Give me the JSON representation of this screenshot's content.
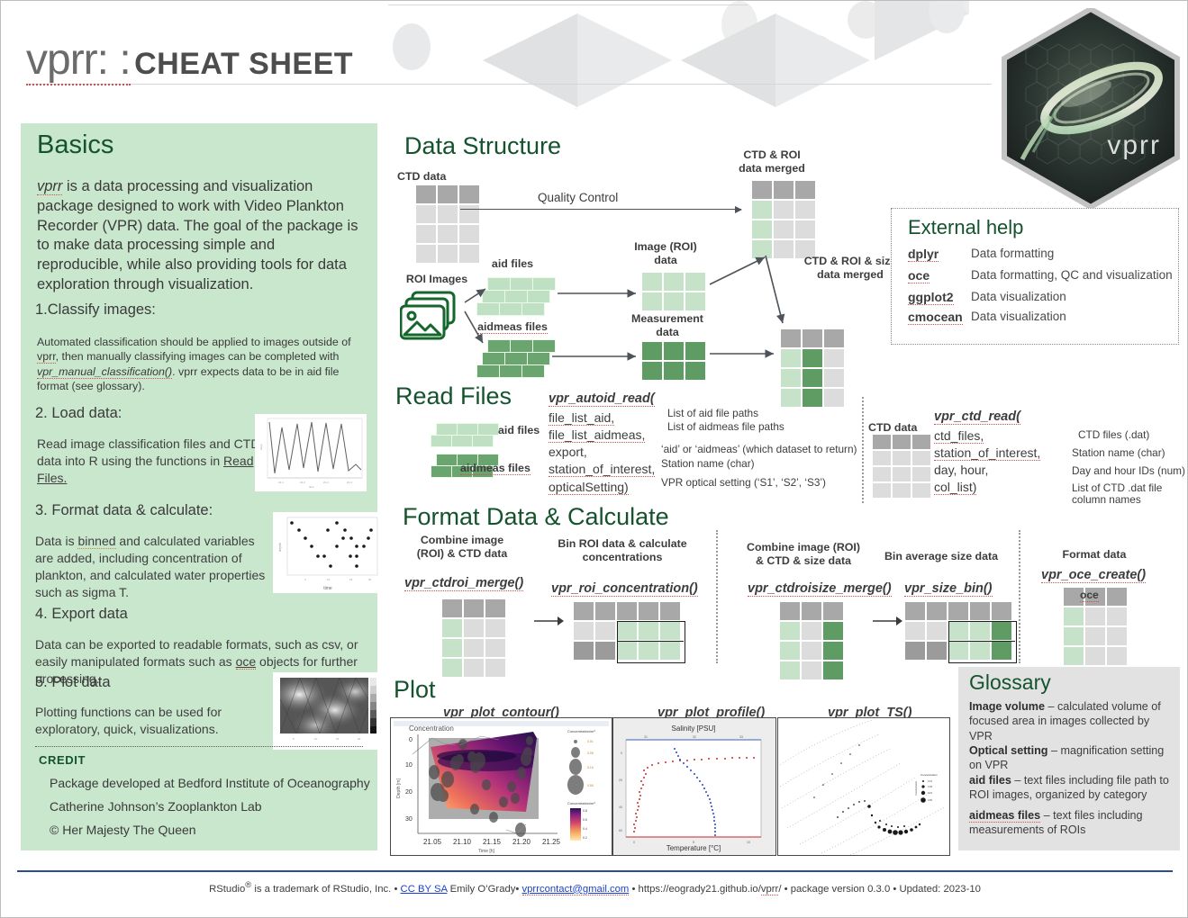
{
  "title": {
    "package": "vprr: :",
    "suffix": "CHEAT SHEET"
  },
  "logo": {
    "label": "vprr"
  },
  "basics": {
    "heading": "Basics",
    "intro_pkg": "vprr",
    "intro": " is a data processing and visualization package designed to work with Video Plankton Recorder  (VPR) data. The goal of the package is to make data processing simple and reproducible, while also providing tools for data exploration through visualization.",
    "steps": [
      {
        "num": "1.",
        "title": "Classify images:",
        "body_a": "Automated classification should be applied to images outside of ",
        "body_pkg1": "vprr",
        "body_b": ", then manually classifying images can be completed with ",
        "body_fn": "vpr_manual_classification()",
        "body_c": ".  vprr expects data to be in aid file format (see glossary)."
      },
      {
        "num": "2.",
        "title": "Load data:",
        "body_a": "Read image classification files and CTD data into R using the functions in ",
        "link": "Read Files."
      },
      {
        "num": "3.",
        "title": "Format data & calculate:",
        "body_a": " Data is ",
        "word": "binned",
        "body_b": " and calculated variables are added, including concentration of plankton, and calculated water properties such as sigma T."
      },
      {
        "num": "4.",
        "title": "Export data",
        "body_a": "Data can be exported to readable formats, such as csv, or easily manipulated formats such as ",
        "word": "oce",
        "body_b": " objects for further processing."
      },
      {
        "num": "5.",
        "title": "Plot data",
        "body_a": "Plotting functions can be used for exploratory, quick, visualizations."
      }
    ],
    "credit_heading": "CREDIT",
    "credit_lines": [
      "Package developed at Bedford Institute of Oceanography",
      "Catherine Johnson’s Zooplankton Lab",
      "© Her Majesty The Queen"
    ]
  },
  "data_structure": {
    "heading": "Data Structure",
    "labels": {
      "ctd_data": "CTD data",
      "roi_images": "ROI Images",
      "aid_files": "aid files",
      "aidmeas_files": "aidmeas files",
      "image_roi_data": "Image (ROI)\ndata",
      "measurement_data": "Measurement\ndata",
      "ctd_roi_merged": "CTD & ROI\ndata merged",
      "ctd_roi_size_merged": "CTD & ROI & size\ndata merged",
      "quality_control": "Quality Control"
    }
  },
  "external_help": {
    "heading": "External help",
    "rows": [
      {
        "pkg": "dplyr",
        "desc": "Data formatting"
      },
      {
        "pkg": "oce",
        "desc": "Data formatting, QC and visualization"
      },
      {
        "pkg": "ggplot2",
        "desc": "Data visualization"
      },
      {
        "pkg": "cmocean",
        "desc": "Data visualization"
      }
    ]
  },
  "read_files": {
    "heading": "Read Files",
    "aid_label": "aid files",
    "aidmeas_label": "aidmeas files",
    "ctd_label": "CTD data",
    "autoid": {
      "fn": "vpr_autoid_read(",
      "args": [
        "file_list_aid,",
        "file_list_aidmeas,",
        "export,",
        "station_of_interest,",
        "opticalSetting)"
      ],
      "descs": [
        "List of aid file paths",
        "List of aidmeas file paths",
        "‘aid’ or ‘aidmeas’  (which dataset to return)",
        "Station name (char)",
        "VPR optical setting (‘S1’, ‘S2’, ‘S3’)"
      ]
    },
    "ctd_read": {
      "fn": "vpr_ctd_read(",
      "args": [
        "ctd_files,",
        "station_of_interest,",
        " day, hour,",
        "col_list)"
      ],
      "descs": [
        "CTD files (.dat)",
        "Station name (char)",
        "Day and hour IDs (num)",
        "List of CTD .dat file",
        "column names"
      ]
    }
  },
  "format_data": {
    "heading": "Format Data & Calculate",
    "items": [
      {
        "label": "Combine image\n(ROI) & CTD data",
        "fn": "vpr_ctdroi_merge()"
      },
      {
        "label": "Bin ROI data & calculate\nconcentrations",
        "fn": "vpr_roi_concentration()"
      },
      {
        "label": "Combine image (ROI)\n& CTD & size data",
        "fn": "vpr_ctdroisize_merge()"
      },
      {
        "label": "Bin average size data",
        "fn": "vpr_size_bin()"
      },
      {
        "label": "Format data",
        "fn": "vpr_oce_create()",
        "cell": "oce"
      }
    ]
  },
  "plot": {
    "heading": "Plot",
    "captions": [
      "vpr_plot_contour()",
      "vpr_plot_profile()",
      "vpr_plot_TS()"
    ],
    "contour": {
      "title": "Concentration",
      "xlabel": "Time [h]",
      "ylabel": "Depth [m]",
      "xticks": [
        "21.05",
        "21.10",
        "21.15",
        "21.20",
        "21.25"
      ],
      "yticks": [
        "0",
        "10",
        "20",
        "30"
      ],
      "legend1": "Concentration/m³",
      "legend2": "Concentration/m³"
    },
    "profile": {
      "top_axis": "Salinity [PSU]",
      "bottom_axis": "Temperature [°C]"
    },
    "ts": {
      "legend": "Concentration"
    }
  },
  "glossary": {
    "heading": "Glossary",
    "entries": [
      {
        "term": "Image volume",
        "def": " – calculated volume of focused area in images collected by VPR"
      },
      {
        "term": "Optical setting",
        "def": " – magnification setting on VPR"
      },
      {
        "term": "aid files",
        "def": " – text files including file path to ROI images, organized by category"
      },
      {
        "term": "aidmeas files",
        "def": " – text files including measurements of ROIs"
      }
    ]
  },
  "footer": {
    "trademark": "RStudio",
    "trademark_sup": "®",
    "trademark_rest": " is a trademark of RStudio, Inc.  •  ",
    "cc": "CC BY SA",
    "author": " Emily O’Grady•  ",
    "email": "vprrcontact@gmail.com",
    "site_pre": " • https://eogrady21.github.io/",
    "site_pkg": "vprr",
    "site_post": "/ •  package version  0.3.0  •  Updated: 2023-10"
  }
}
